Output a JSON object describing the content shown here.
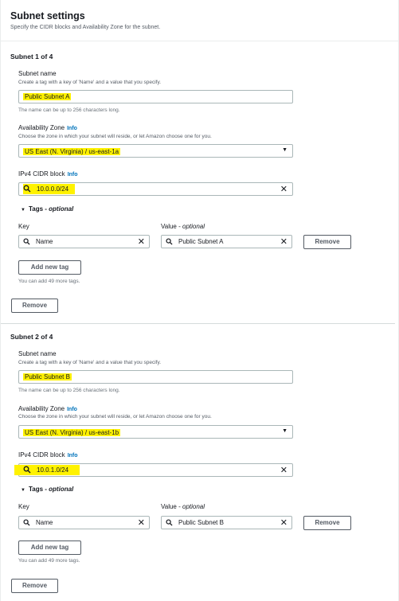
{
  "header": {
    "title": "Subnet settings",
    "description": "Specify the CIDR blocks and Availability Zone for the subnet."
  },
  "labels": {
    "subnet_name": "Subnet name",
    "subnet_name_desc": "Create a tag with a key of 'Name' and a value that you specify.",
    "subnet_name_hint": "The name can be up to 256 characters long.",
    "az": "Availability Zone",
    "az_desc": "Choose the zone in which your subnet will reside, or let Amazon choose one for you.",
    "cidr": "IPv4 CIDR block",
    "info": "Info",
    "tags": "Tags -",
    "tags_optional": "optional",
    "key": "Key",
    "value": "Value -",
    "value_optional": "optional",
    "remove": "Remove",
    "add_new_tag": "Add new tag",
    "add_more_hint": "You can add 49 more tags."
  },
  "subnets": [
    {
      "title": "Subnet 1 of 4",
      "name": "Public Subnet A",
      "az": "US East (N. Virginia) / us-east-1a",
      "cidr": "10.0.0.0/24",
      "tag_key": "Name",
      "tag_value": "Public Subnet A"
    },
    {
      "title": "Subnet 2 of 4",
      "name": "Public Subnet B",
      "az": "US East (N. Virginia) / us-east-1b",
      "cidr": "10.0.1.0/24",
      "tag_key": "Name",
      "tag_value": "Public Subnet B"
    }
  ],
  "colors": {
    "highlight": "#fff200",
    "info_link": "#0073bb"
  }
}
